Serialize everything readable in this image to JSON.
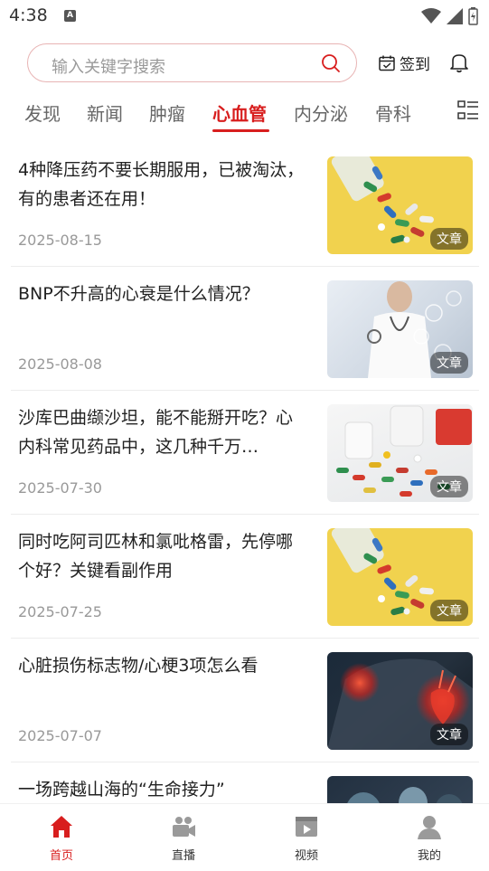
{
  "status": {
    "time": "4:38"
  },
  "search": {
    "placeholder": "输入关键字搜索"
  },
  "header": {
    "signin_label": "签到"
  },
  "tabs": [
    {
      "label": "发现"
    },
    {
      "label": "新闻"
    },
    {
      "label": "肿瘤"
    },
    {
      "label": "心血管"
    },
    {
      "label": "内分泌"
    },
    {
      "label": "骨科"
    }
  ],
  "active_tab": "心血管",
  "articles": [
    {
      "title": "4种降压药不要长期服用，已被淘汰，有的患者还在用！",
      "date": "2025-08-15",
      "badge": "文章",
      "thumb": "pills-bottle-yellow"
    },
    {
      "title": "BNP不升高的心衰是什么情况？",
      "date": "2025-08-08",
      "badge": "文章",
      "thumb": "doctor-stethoscope"
    },
    {
      "title": "沙库巴曲缬沙坦，能不能掰开吃？心内科常见药品中，这几种千万…",
      "date": "2025-07-30",
      "badge": "文章",
      "thumb": "pills-spilled-white"
    },
    {
      "title": "同时吃阿司匹林和氯吡格雷，先停哪个好？关键看副作用",
      "date": "2025-07-25",
      "badge": "文章",
      "thumb": "pills-bottle-yellow"
    },
    {
      "title": "心脏损伤标志物/心梗3项怎么看",
      "date": "2025-07-07",
      "badge": "文章",
      "thumb": "heart-glowing"
    },
    {
      "title": "一场跨越山海的“生命接力”",
      "date": "",
      "badge": "",
      "thumb": "surgery-team"
    }
  ],
  "bottom_nav": [
    {
      "label": "首页",
      "icon": "home-icon"
    },
    {
      "label": "直播",
      "icon": "live-camera-icon"
    },
    {
      "label": "视频",
      "icon": "video-icon"
    },
    {
      "label": "我的",
      "icon": "profile-icon"
    }
  ],
  "colors": {
    "accent": "#d81e1e",
    "thumb_yellow": "#f1d24e"
  }
}
